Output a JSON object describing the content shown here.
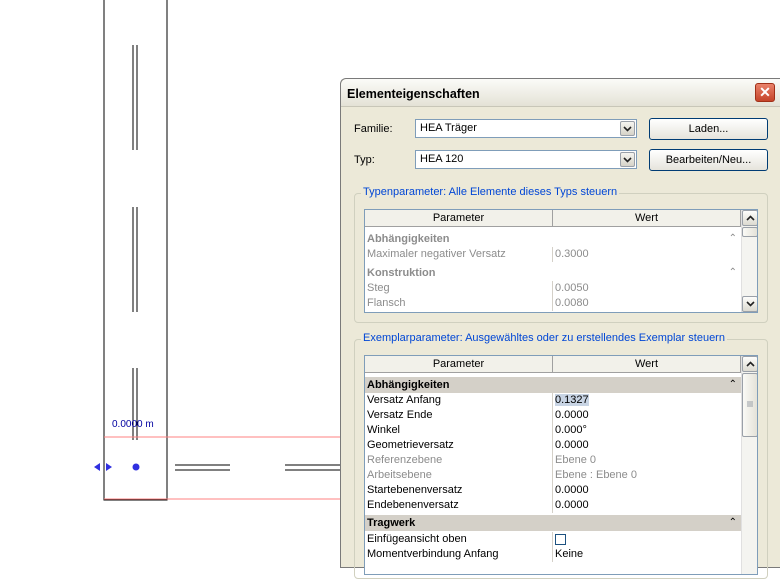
{
  "canvas": {
    "dimension_label": "0.0000 m"
  },
  "dialog": {
    "title": "Elementeigenschaften",
    "family_label": "Familie:",
    "family_value": "HEA Träger",
    "type_label": "Typ:",
    "type_value": "HEA 120",
    "load_button": "Laden...",
    "edit_button": "Bearbeiten/Neu...",
    "type_params": {
      "title": "Typenparameter: Alle Elemente dieses Typs steuern",
      "col_param": "Parameter",
      "col_value": "Wert",
      "rows": [
        {
          "kind": "cat",
          "name": "Abhängigkeiten"
        },
        {
          "kind": "row",
          "name": "Maximaler negativer Versatz",
          "value": "0.3000"
        },
        {
          "kind": "cat",
          "name": "Konstruktion"
        },
        {
          "kind": "row",
          "name": "Steg",
          "value": "0.0050"
        },
        {
          "kind": "row",
          "name": "Flansch",
          "value": "0.0080"
        }
      ]
    },
    "instance_params": {
      "title": "Exemplarparameter: Ausgewähltes oder zu erstellendes Exemplar steuern",
      "col_param": "Parameter",
      "col_value": "Wert",
      "rows": [
        {
          "kind": "cat",
          "name": "Abhängigkeiten"
        },
        {
          "kind": "row",
          "name": "Versatz Anfang",
          "value": "0.1327",
          "selected": true
        },
        {
          "kind": "row",
          "name": "Versatz Ende",
          "value": "0.0000"
        },
        {
          "kind": "row",
          "name": "Winkel",
          "value": "0.000°"
        },
        {
          "kind": "row",
          "name": "Geometrieversatz",
          "value": "0.0000"
        },
        {
          "kind": "row",
          "name": "Referenzebene",
          "value": "Ebene 0",
          "disabled": true
        },
        {
          "kind": "row",
          "name": "Arbeitsebene",
          "value": "Ebene : Ebene 0",
          "disabled": true
        },
        {
          "kind": "row",
          "name": "Startebenenversatz",
          "value": "0.0000"
        },
        {
          "kind": "row",
          "name": "Endebenenversatz",
          "value": "0.0000"
        },
        {
          "kind": "cat",
          "name": "Tragwerk"
        },
        {
          "kind": "check",
          "name": "Einfügeansicht oben",
          "value": ""
        },
        {
          "kind": "row",
          "name": "Momentverbindung Anfang",
          "value": "Keine"
        }
      ]
    }
  },
  "colors": {
    "accent": "#0046d5",
    "close": "#c5442a",
    "ref_line": "#ff8080",
    "marker": "#3030e0"
  },
  "icons": [
    "close-icon",
    "chevron-down-icon",
    "chevron-up-icon",
    "collapse-icon",
    "grip-icon"
  ]
}
